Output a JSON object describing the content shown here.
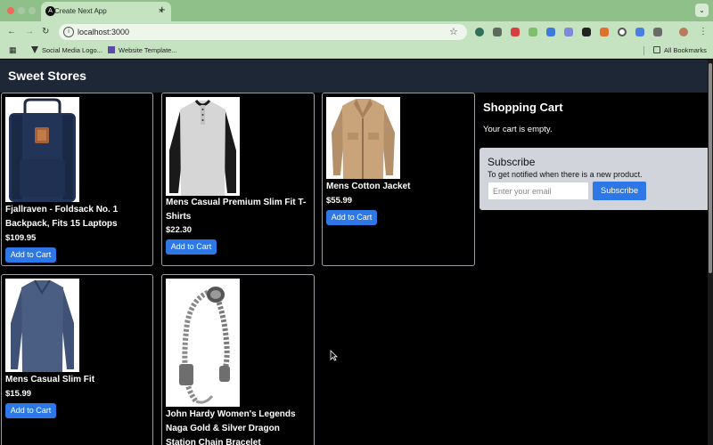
{
  "browser": {
    "tab_title": "Create Next App",
    "tab_favicon": "A",
    "tab_close": "×",
    "new_tab": "+",
    "tab_search": "⌄",
    "url": "localhost:3000",
    "bookmarks": [
      {
        "label": "Social Media Logo...",
        "icon": "bookmark-favicon-icon"
      },
      {
        "label": "Website Template...",
        "icon": "bookmark-favicon-icon"
      }
    ],
    "all_bookmarks": "All Bookmarks",
    "colors": {
      "chrome": "#8fc08a",
      "toolbar": "#c6e3c1"
    }
  },
  "site": {
    "title": "Sweet Stores",
    "header_color": "#1e2735",
    "accent": "#2d78e6"
  },
  "products": [
    {
      "name_lines": [
        "Fjallraven - Foldsack No. 1",
        "Backpack, Fits 15 Laptops"
      ],
      "price": "$109.95",
      "button": "Add to Cart",
      "image": "backpack-image"
    },
    {
      "name_lines": [
        "Mens Casual Premium Slim Fit T-",
        "Shirts"
      ],
      "price": "$22.30",
      "button": "Add to Cart",
      "image": "tshirt-image"
    },
    {
      "name_lines": [
        "Mens Cotton Jacket"
      ],
      "price": "$55.99",
      "button": "Add to Cart",
      "image": "jacket-image"
    },
    {
      "name_lines": [
        "Mens Casual Slim Fit"
      ],
      "price": "$15.99",
      "button": "Add to Cart",
      "image": "longsleeve-image"
    },
    {
      "name_lines": [
        "John Hardy Women's Legends",
        "Naga Gold & Silver Dragon",
        "Station Chain Bracelet"
      ],
      "price": "",
      "button": "",
      "image": "bracelet-image"
    }
  ],
  "cart": {
    "title": "Shopping Cart",
    "empty_text": "Your cart is empty."
  },
  "subscribe": {
    "title": "Subscribe",
    "description": "To get notified when there is a new product.",
    "placeholder": "Enter your email",
    "button": "Subscribe"
  }
}
